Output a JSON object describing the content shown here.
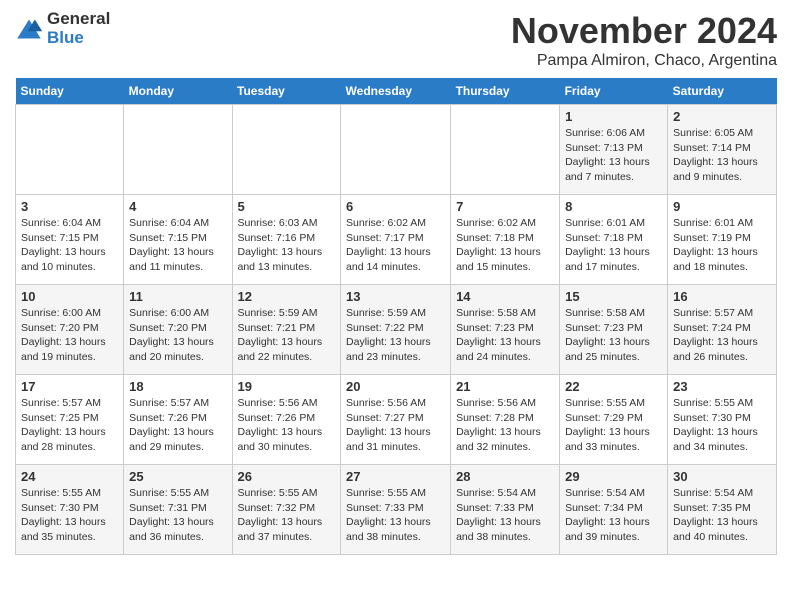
{
  "logo": {
    "text_general": "General",
    "text_blue": "Blue"
  },
  "header": {
    "month_title": "November 2024",
    "location": "Pampa Almiron, Chaco, Argentina"
  },
  "weekdays": [
    "Sunday",
    "Monday",
    "Tuesday",
    "Wednesday",
    "Thursday",
    "Friday",
    "Saturday"
  ],
  "weeks": [
    [
      {
        "day": "",
        "lines": []
      },
      {
        "day": "",
        "lines": []
      },
      {
        "day": "",
        "lines": []
      },
      {
        "day": "",
        "lines": []
      },
      {
        "day": "",
        "lines": []
      },
      {
        "day": "1",
        "lines": [
          "Sunrise: 6:06 AM",
          "Sunset: 7:13 PM",
          "Daylight: 13 hours",
          "and 7 minutes."
        ]
      },
      {
        "day": "2",
        "lines": [
          "Sunrise: 6:05 AM",
          "Sunset: 7:14 PM",
          "Daylight: 13 hours",
          "and 9 minutes."
        ]
      }
    ],
    [
      {
        "day": "3",
        "lines": [
          "Sunrise: 6:04 AM",
          "Sunset: 7:15 PM",
          "Daylight: 13 hours",
          "and 10 minutes."
        ]
      },
      {
        "day": "4",
        "lines": [
          "Sunrise: 6:04 AM",
          "Sunset: 7:15 PM",
          "Daylight: 13 hours",
          "and 11 minutes."
        ]
      },
      {
        "day": "5",
        "lines": [
          "Sunrise: 6:03 AM",
          "Sunset: 7:16 PM",
          "Daylight: 13 hours",
          "and 13 minutes."
        ]
      },
      {
        "day": "6",
        "lines": [
          "Sunrise: 6:02 AM",
          "Sunset: 7:17 PM",
          "Daylight: 13 hours",
          "and 14 minutes."
        ]
      },
      {
        "day": "7",
        "lines": [
          "Sunrise: 6:02 AM",
          "Sunset: 7:18 PM",
          "Daylight: 13 hours",
          "and 15 minutes."
        ]
      },
      {
        "day": "8",
        "lines": [
          "Sunrise: 6:01 AM",
          "Sunset: 7:18 PM",
          "Daylight: 13 hours",
          "and 17 minutes."
        ]
      },
      {
        "day": "9",
        "lines": [
          "Sunrise: 6:01 AM",
          "Sunset: 7:19 PM",
          "Daylight: 13 hours",
          "and 18 minutes."
        ]
      }
    ],
    [
      {
        "day": "10",
        "lines": [
          "Sunrise: 6:00 AM",
          "Sunset: 7:20 PM",
          "Daylight: 13 hours",
          "and 19 minutes."
        ]
      },
      {
        "day": "11",
        "lines": [
          "Sunrise: 6:00 AM",
          "Sunset: 7:20 PM",
          "Daylight: 13 hours",
          "and 20 minutes."
        ]
      },
      {
        "day": "12",
        "lines": [
          "Sunrise: 5:59 AM",
          "Sunset: 7:21 PM",
          "Daylight: 13 hours",
          "and 22 minutes."
        ]
      },
      {
        "day": "13",
        "lines": [
          "Sunrise: 5:59 AM",
          "Sunset: 7:22 PM",
          "Daylight: 13 hours",
          "and 23 minutes."
        ]
      },
      {
        "day": "14",
        "lines": [
          "Sunrise: 5:58 AM",
          "Sunset: 7:23 PM",
          "Daylight: 13 hours",
          "and 24 minutes."
        ]
      },
      {
        "day": "15",
        "lines": [
          "Sunrise: 5:58 AM",
          "Sunset: 7:23 PM",
          "Daylight: 13 hours",
          "and 25 minutes."
        ]
      },
      {
        "day": "16",
        "lines": [
          "Sunrise: 5:57 AM",
          "Sunset: 7:24 PM",
          "Daylight: 13 hours",
          "and 26 minutes."
        ]
      }
    ],
    [
      {
        "day": "17",
        "lines": [
          "Sunrise: 5:57 AM",
          "Sunset: 7:25 PM",
          "Daylight: 13 hours",
          "and 28 minutes."
        ]
      },
      {
        "day": "18",
        "lines": [
          "Sunrise: 5:57 AM",
          "Sunset: 7:26 PM",
          "Daylight: 13 hours",
          "and 29 minutes."
        ]
      },
      {
        "day": "19",
        "lines": [
          "Sunrise: 5:56 AM",
          "Sunset: 7:26 PM",
          "Daylight: 13 hours",
          "and 30 minutes."
        ]
      },
      {
        "day": "20",
        "lines": [
          "Sunrise: 5:56 AM",
          "Sunset: 7:27 PM",
          "Daylight: 13 hours",
          "and 31 minutes."
        ]
      },
      {
        "day": "21",
        "lines": [
          "Sunrise: 5:56 AM",
          "Sunset: 7:28 PM",
          "Daylight: 13 hours",
          "and 32 minutes."
        ]
      },
      {
        "day": "22",
        "lines": [
          "Sunrise: 5:55 AM",
          "Sunset: 7:29 PM",
          "Daylight: 13 hours",
          "and 33 minutes."
        ]
      },
      {
        "day": "23",
        "lines": [
          "Sunrise: 5:55 AM",
          "Sunset: 7:30 PM",
          "Daylight: 13 hours",
          "and 34 minutes."
        ]
      }
    ],
    [
      {
        "day": "24",
        "lines": [
          "Sunrise: 5:55 AM",
          "Sunset: 7:30 PM",
          "Daylight: 13 hours",
          "and 35 minutes."
        ]
      },
      {
        "day": "25",
        "lines": [
          "Sunrise: 5:55 AM",
          "Sunset: 7:31 PM",
          "Daylight: 13 hours",
          "and 36 minutes."
        ]
      },
      {
        "day": "26",
        "lines": [
          "Sunrise: 5:55 AM",
          "Sunset: 7:32 PM",
          "Daylight: 13 hours",
          "and 37 minutes."
        ]
      },
      {
        "day": "27",
        "lines": [
          "Sunrise: 5:55 AM",
          "Sunset: 7:33 PM",
          "Daylight: 13 hours",
          "and 38 minutes."
        ]
      },
      {
        "day": "28",
        "lines": [
          "Sunrise: 5:54 AM",
          "Sunset: 7:33 PM",
          "Daylight: 13 hours",
          "and 38 minutes."
        ]
      },
      {
        "day": "29",
        "lines": [
          "Sunrise: 5:54 AM",
          "Sunset: 7:34 PM",
          "Daylight: 13 hours",
          "and 39 minutes."
        ]
      },
      {
        "day": "30",
        "lines": [
          "Sunrise: 5:54 AM",
          "Sunset: 7:35 PM",
          "Daylight: 13 hours",
          "and 40 minutes."
        ]
      }
    ]
  ]
}
